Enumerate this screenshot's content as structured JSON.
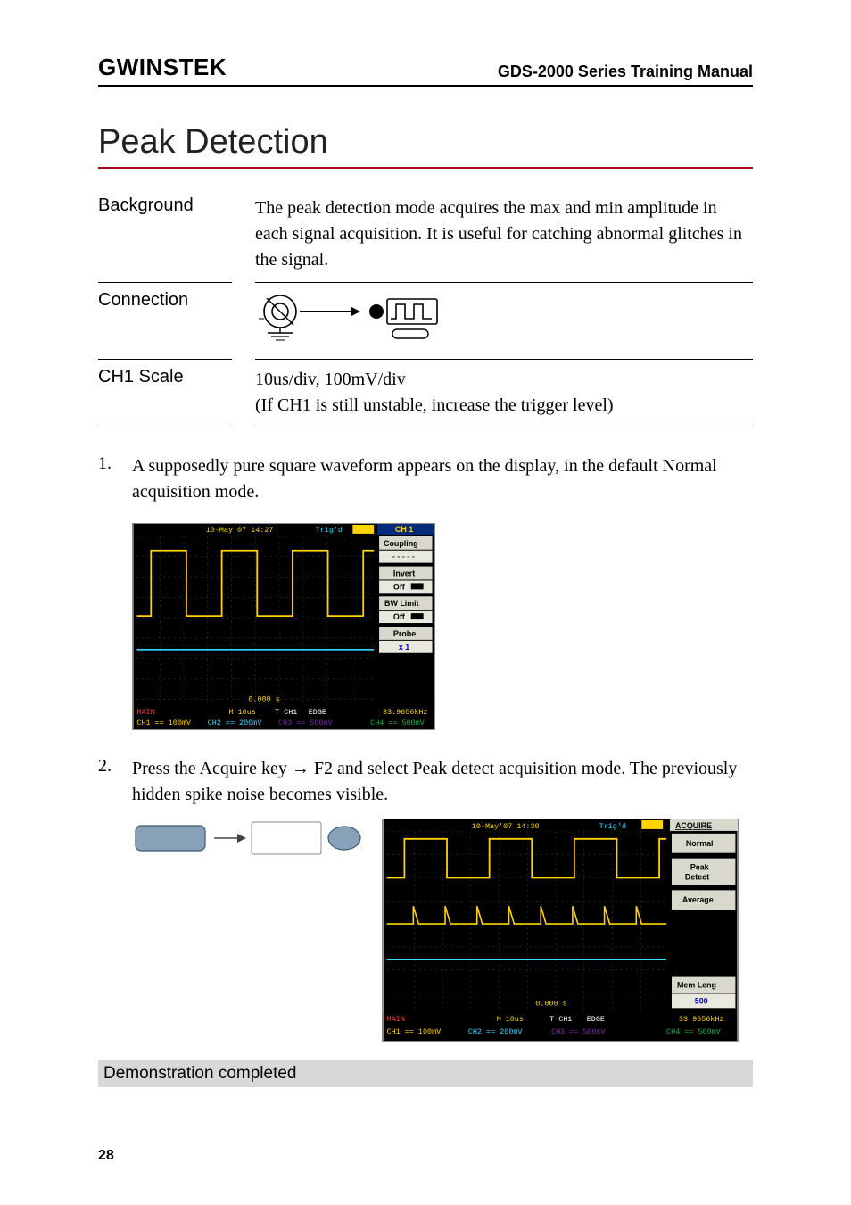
{
  "header": {
    "brand": "GWINSTEK",
    "manual_title": "GDS-2000 Series Training Manual"
  },
  "section_title": "Peak Detection",
  "rows": {
    "background": {
      "label": "Background",
      "text": "The peak detection mode acquires the max and min amplitude in each signal acquisition. It is useful for catching abnormal glitches in the signal."
    },
    "connection": {
      "label": "Connection"
    },
    "ch1scale": {
      "label": "CH1 Scale",
      "line1": "10us/div, 100mV/div",
      "line2": "(If CH1 is still unstable, increase the trigger level)"
    }
  },
  "steps": {
    "s1": {
      "num": "1.",
      "text": "A supposedly pure square waveform appears on the display, in the default Normal acquisition mode."
    },
    "s2": {
      "num": "2.",
      "text": "Press the Acquire key → F2 and select Peak detect acquisition mode. The previously hidden spike noise becomes visible."
    }
  },
  "scope1": {
    "date": "10-May'07 14:27",
    "trig": "Trig'd",
    "side_title": "CH 1",
    "btn_coupling": "Coupling",
    "coupling_val": "- - - - -",
    "btn_invert": "Invert",
    "invert_val": "Off",
    "btn_bwlimit": "BW Limit",
    "bwlimit_val": "Off",
    "btn_probe": "Probe",
    "probe_val": "x 1",
    "main_label": "MAIN",
    "m_time": "M 10us",
    "tch": "T CH1",
    "edge": "EDGE",
    "freq": "33.9656kHz",
    "ch1": "CH1 == 100mV",
    "ch2": "CH2 == 200mV",
    "ch3": "CH3 == 500mV",
    "ch4": "CH4 == 500mV",
    "time_marker": "0.000 s"
  },
  "scope2": {
    "date": "10-May'07 14:30",
    "trig": "Trig'd",
    "side_title": "ACQUIRE",
    "btn_normal": "Normal",
    "btn_peak": "Peak Detect",
    "btn_avg": "Average",
    "btn_memleng": "Mem Leng",
    "memleng_val": "500",
    "main_label": "MAIN",
    "m_time": "M 10us",
    "tch": "T CH1",
    "edge": "EDGE",
    "freq": "33.9656kHz",
    "ch1": "CH1 == 100mV",
    "ch2": "CH2 == 200mV",
    "ch3": "CH3 == 500mV",
    "ch4": "CH4 == 500mV",
    "time_marker": "0.000 s"
  },
  "demo_done": "Demonstration completed",
  "page_number": "28",
  "chart_data": [
    {
      "type": "line",
      "title": "Square waveform (Normal acquisition)",
      "annotations": [
        "CH 1 menu active",
        "Coupling",
        "Invert Off",
        "BW Limit Off",
        "Probe x1"
      ],
      "series": [
        {
          "name": "CH1 square wave (yellow)",
          "timebase": "10us/div",
          "amplitude": "100mV/div",
          "values": "periodic square wave with small noise"
        },
        {
          "name": "CH2 baseline (cyan)",
          "values": "flat reference at lower grid"
        }
      ],
      "x_marker": "0.000 s"
    },
    {
      "type": "line",
      "title": "Square waveform with spike noise (Peak Detect acquisition)",
      "annotations": [
        "ACQUIRE menu active",
        "Normal",
        "Peak Detect (selected)",
        "Average",
        "Mem Leng 500"
      ],
      "series": [
        {
          "name": "CH1 upper square wave (yellow)",
          "timebase": "10us/div",
          "amplitude": "100mV/div",
          "values": "periodic square wave, clean"
        },
        {
          "name": "CH1 lower envelope with spikes (yellow)",
          "values": "periodic spike noise revealed by peak detect"
        },
        {
          "name": "CH2 baseline (cyan)",
          "values": "flat reference at lower grid"
        }
      ],
      "x_marker": "0.000 s"
    }
  ]
}
